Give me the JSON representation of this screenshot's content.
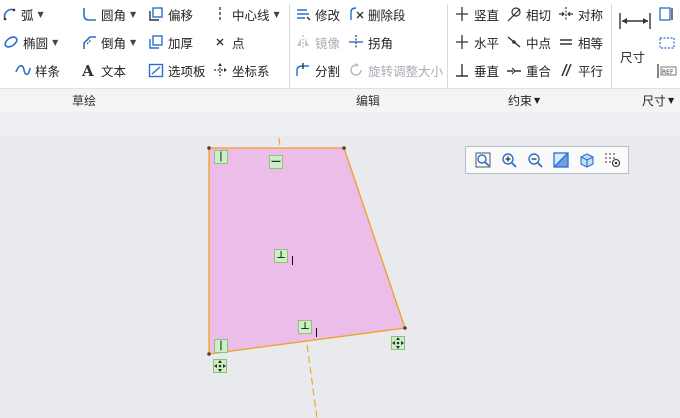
{
  "ribbon": {
    "groups": {
      "sketch": "草绘",
      "edit": "编辑",
      "constrain": "约束",
      "dimension": "尺寸"
    },
    "sketch_tools": {
      "arc": "弧",
      "ellipse": "椭圆",
      "spline": "样条",
      "fillet": "圆角",
      "chamfer": "倒角",
      "text": "文本",
      "offset": "偏移",
      "thicken": "加厚",
      "palette": "选项板",
      "centerline": "中心线",
      "point": "点",
      "coord_sys": "坐标系"
    },
    "edit_tools": {
      "modify": "修改",
      "delete_segment": "删除段",
      "mirror": "镜像",
      "corner": "拐角",
      "divide": "分割",
      "rotate_resize": "旋转调整大小"
    },
    "constrain_tools": {
      "vertical": "竖直",
      "tangent": "相切",
      "symmetric": "对称",
      "horizontal": "水平",
      "midpoint": "中点",
      "equal": "相等",
      "perpendicular": "垂直",
      "coincident": "重合",
      "parallel": "平行"
    },
    "dimension_tools": {
      "dimension": "尺寸"
    }
  },
  "colors": {
    "sketch_fill": "#ecbde9",
    "sketch_edge": "#f0a020",
    "centerline": "#f0a020",
    "constraint_marker_bg": "#cfeec7",
    "accent_blue": "#2a6fd0"
  },
  "view_toolbar": {
    "buttons": [
      "zoom-fit-icon",
      "zoom-in-icon",
      "zoom-out-icon",
      "refit-icon",
      "display-style-icon",
      "sketch-display-icon"
    ]
  },
  "constraint_markers": {
    "vertical_symbol": "|",
    "horizontal_symbol": "—",
    "perpendicular_symbol": "⊥"
  }
}
